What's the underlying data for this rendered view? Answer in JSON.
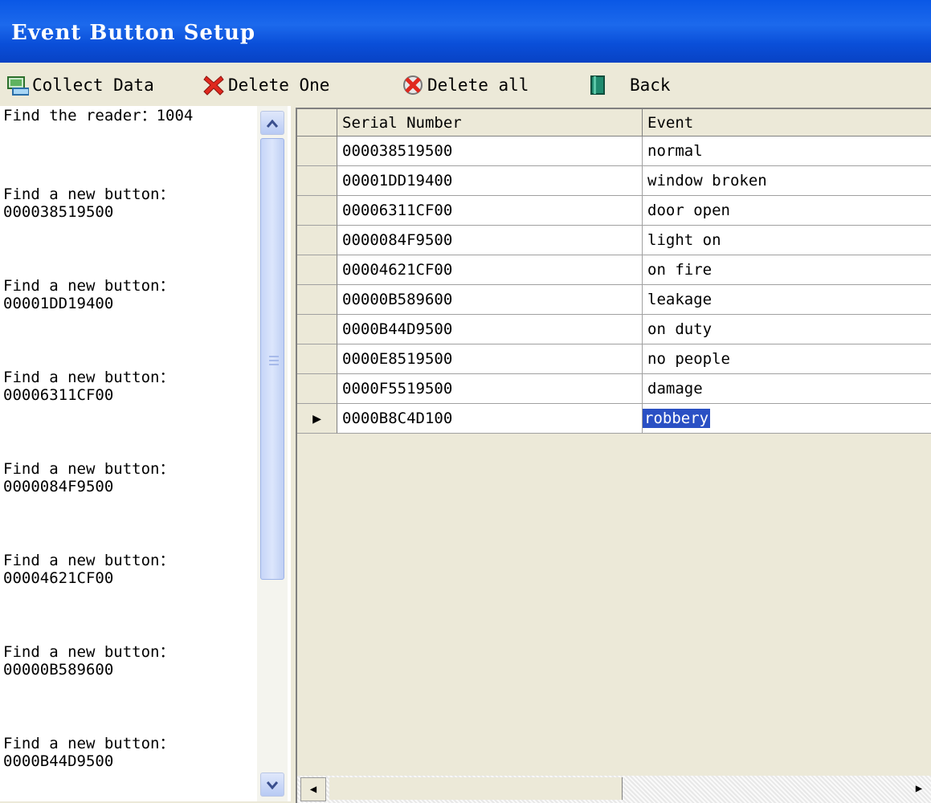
{
  "window": {
    "title": "Event Button Setup"
  },
  "toolbar": {
    "collect_data": "Collect Data",
    "delete_one": "Delete One",
    "delete_all": "Delete all",
    "back": "Back"
  },
  "log": {
    "reader_label": "Find the reader：1004",
    "found_label": "Find a new button：",
    "entries": [
      "000038519500",
      "00001DD19400",
      "00006311CF00",
      "0000084F9500",
      "00004621CF00",
      "00000B589600",
      "0000B44D9500"
    ]
  },
  "grid": {
    "columns": [
      "Serial Number",
      "Event"
    ],
    "rows": [
      {
        "serial": "000038519500",
        "event": "normal"
      },
      {
        "serial": "00001DD19400",
        "event": "window broken"
      },
      {
        "serial": "00006311CF00",
        "event": "door open"
      },
      {
        "serial": "0000084F9500",
        "event": "light on"
      },
      {
        "serial": "00004621CF00",
        "event": "on fire"
      },
      {
        "serial": "00000B589600",
        "event": "leakage"
      },
      {
        "serial": "0000B44D9500",
        "event": "on duty"
      },
      {
        "serial": "0000E8519500",
        "event": "no people"
      },
      {
        "serial": "0000F5519500",
        "event": "damage"
      },
      {
        "serial": "0000B8C4D100",
        "event": "robbery"
      }
    ],
    "current_row_indicator": "▶",
    "selected_event": "robbery"
  },
  "colors": {
    "titlebar": "#0a58e6",
    "selection": "#2a50c4",
    "face": "#ece9d8"
  }
}
